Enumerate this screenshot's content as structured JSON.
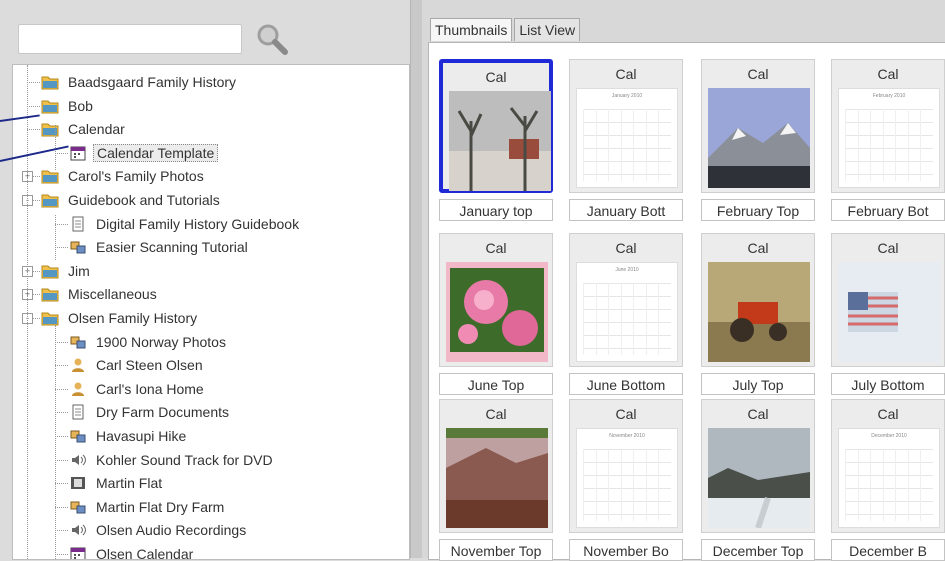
{
  "search": {
    "placeholder": "",
    "value": ""
  },
  "tree": [
    {
      "label": "Baadsgaard Family History",
      "icon": "folder-icon"
    },
    {
      "label": "Bob",
      "icon": "folder-icon"
    },
    {
      "label": "Calendar",
      "icon": "folder-icon"
    },
    {
      "label": "Calendar Template",
      "icon": "calendar-icon",
      "selected": true
    },
    {
      "label": "Carol's Family Photos",
      "icon": "folder-icon"
    },
    {
      "label": "Guidebook and Tutorials",
      "icon": "folder-icon"
    },
    {
      "label": "Digital Family History Guidebook",
      "icon": "document-icon"
    },
    {
      "label": "Easier Scanning Tutorial",
      "icon": "photo-album-icon"
    },
    {
      "label": "Jim",
      "icon": "folder-icon"
    },
    {
      "label": "Miscellaneous",
      "icon": "folder-icon"
    },
    {
      "label": "Olsen Family History",
      "icon": "folder-icon"
    },
    {
      "label": "1900 Norway Photos",
      "icon": "photo-album-icon"
    },
    {
      "label": "Carl Steen Olsen",
      "icon": "person-icon"
    },
    {
      "label": "Carl's Iona Home",
      "icon": "person-icon"
    },
    {
      "label": "Dry Farm Documents",
      "icon": "document-icon"
    },
    {
      "label": "Havasupi Hike",
      "icon": "photo-album-icon"
    },
    {
      "label": "Kohler Sound Track for DVD",
      "icon": "audio-icon"
    },
    {
      "label": "Martin Flat",
      "icon": "film-icon"
    },
    {
      "label": "Martin Flat Dry Farm",
      "icon": "photo-album-icon"
    },
    {
      "label": "Olsen Audio Recordings",
      "icon": "audio-icon"
    },
    {
      "label": "Olsen Calendar",
      "icon": "calendar-icon"
    }
  ],
  "tabs": [
    {
      "label": "Thumbnails",
      "active": true
    },
    {
      "label": "List View",
      "active": false
    }
  ],
  "thumbnails": [
    {
      "badge": "Cal",
      "name": "January top",
      "kind": "photo-trees",
      "selected": true
    },
    {
      "badge": "Cal",
      "name": "January Bott",
      "kind": "calendar-page",
      "page_title": "January 2010"
    },
    {
      "badge": "Cal",
      "name": "February Top",
      "kind": "photo-mountain"
    },
    {
      "badge": "Cal",
      "name": "February Bot",
      "kind": "calendar-page",
      "page_title": "February 2010"
    },
    {
      "badge": "Cal",
      "name": "June Top",
      "kind": "photo-flowers"
    },
    {
      "badge": "Cal",
      "name": "June Bottom",
      "kind": "calendar-page",
      "page_title": "June 2010"
    },
    {
      "badge": "Cal",
      "name": "July Top",
      "kind": "photo-tractor"
    },
    {
      "badge": "Cal",
      "name": "July Bottom",
      "kind": "photo-flag"
    },
    {
      "badge": "Cal",
      "name": "November Top",
      "kind": "photo-valley"
    },
    {
      "badge": "Cal",
      "name": "November Bo",
      "kind": "calendar-page",
      "page_title": "November 2010"
    },
    {
      "badge": "Cal",
      "name": "December Top",
      "kind": "photo-snow"
    },
    {
      "badge": "Cal",
      "name": "December B",
      "kind": "calendar-page",
      "page_title": "December 2010"
    }
  ],
  "colors": {
    "selection": "#1f2ad6",
    "pointer": "#1e2a8a",
    "folder": "#3a8fd8"
  }
}
